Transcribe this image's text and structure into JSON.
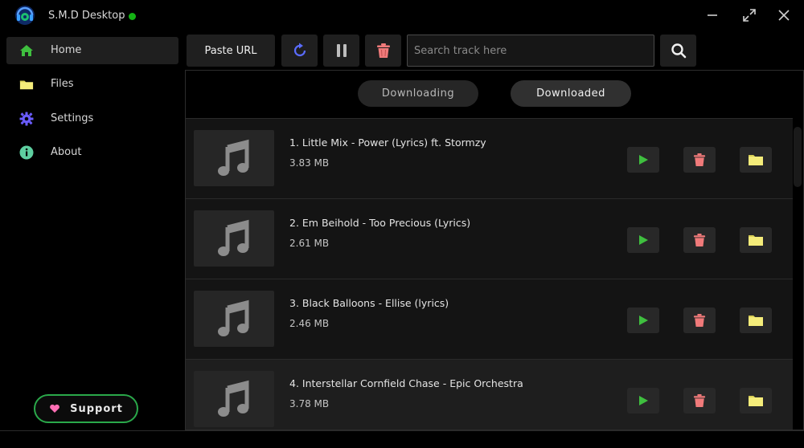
{
  "window": {
    "title": "S.M.D Desktop",
    "status_color": "#14b214"
  },
  "sidebar": {
    "items": [
      {
        "label": "Home",
        "icon": "home-icon",
        "active": true
      },
      {
        "label": "Files",
        "icon": "folder-icon",
        "active": false
      },
      {
        "label": "Settings",
        "icon": "gear-icon",
        "active": false
      },
      {
        "label": "About",
        "icon": "info-icon",
        "active": false
      }
    ],
    "support_label": "Support"
  },
  "toolbar": {
    "paste_label": "Paste URL",
    "refresh_icon": "refresh-icon",
    "pause_icon": "pause-icon",
    "delete_icon": "trash-icon",
    "search_placeholder": "Search track here",
    "search_icon": "search-icon"
  },
  "tabs": [
    {
      "label": "Downloading",
      "active": false
    },
    {
      "label": "Downloaded",
      "active": true
    }
  ],
  "tracks": [
    {
      "title": "1. Little Mix - Power (Lyrics) ft. Stormzy",
      "size": "3.83 MB"
    },
    {
      "title": "2. Em Beihold - Too Precious (Lyrics)",
      "size": "2.61 MB"
    },
    {
      "title": "3. Black Balloons - Ellise (lyrics)",
      "size": "2.46 MB"
    },
    {
      "title": "4. Interstellar Cornfield Chase - Epic Orchestra",
      "size": "3.78 MB"
    }
  ],
  "colors": {
    "accent_green": "#3fbf3f",
    "delete_red": "#f07a7a",
    "folder_yellow": "#f4ec7a",
    "support_border": "#2aa84a"
  }
}
